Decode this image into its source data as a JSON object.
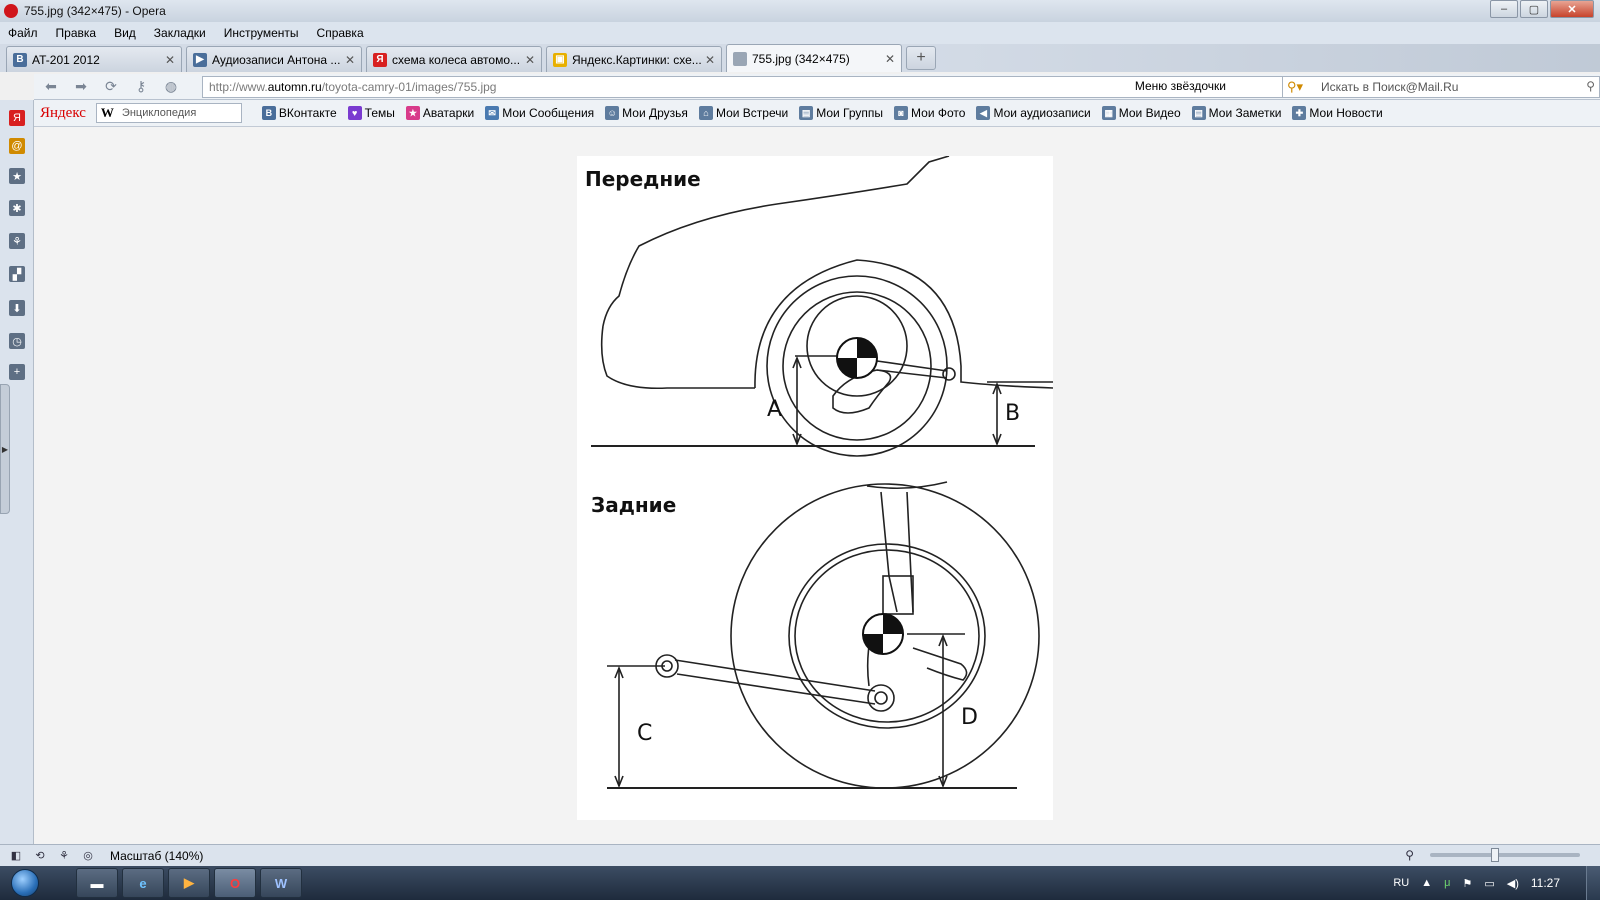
{
  "window": {
    "title": "755.jpg (342×475) - Opera",
    "minimize": "‒",
    "maximize": "▢",
    "close": "✕"
  },
  "menu": [
    "Файл",
    "Правка",
    "Вид",
    "Закладки",
    "Инструменты",
    "Справка"
  ],
  "tabs": [
    {
      "label": "AT-201 2012",
      "icon": "vk-icon",
      "color": "#4a6e9a",
      "glyph": "B",
      "active": false
    },
    {
      "label": "Аудиозаписи Антона ...",
      "icon": "play-icon",
      "color": "#4a6e9a",
      "glyph": "▶",
      "active": false
    },
    {
      "label": "схема колеса автомо...",
      "icon": "yandex-icon",
      "color": "#d82020",
      "glyph": "Я",
      "active": false
    },
    {
      "label": "Яндекс.Картинки: схе...",
      "icon": "yandex-images-icon",
      "color": "#e8b000",
      "glyph": "▣",
      "active": false
    },
    {
      "label": "755.jpg (342×475)",
      "icon": "image-file-icon",
      "color": "#9aa6b5",
      "glyph": "",
      "active": true
    }
  ],
  "address": {
    "prefix": "http://www.",
    "host": "automn.ru",
    "path": "/toyota-camry-01/images/755.jpg",
    "speed_dial_label": "Меню звёздочки",
    "search_placeholder": "Искать в Поиск@Mail.Ru"
  },
  "yandex_bar": {
    "logo": "Яндекс",
    "search_placeholder": "Энциклопедия",
    "search_glyph": "W",
    "links": [
      {
        "label": "ВКонтакте",
        "icon": "vk-icon",
        "color": "#4a6e9a",
        "glyph": "B"
      },
      {
        "label": "Темы",
        "icon": "heart-icon",
        "color": "#7a3bd0",
        "glyph": "♥"
      },
      {
        "label": "Аватарки",
        "icon": "star-icon",
        "color": "#d83a8a",
        "glyph": "★"
      },
      {
        "label": "Мои Сообщения",
        "icon": "envelope-icon",
        "color": "#4a7ab0",
        "glyph": "✉"
      },
      {
        "label": "Мои Друзья",
        "icon": "person-icon",
        "color": "#5e7c9e",
        "glyph": "☺"
      },
      {
        "label": "Мои Встречи",
        "icon": "house-icon",
        "color": "#5e7c9e",
        "glyph": "⌂"
      },
      {
        "label": "Мои Группы",
        "icon": "group-icon",
        "color": "#5e7c9e",
        "glyph": "▤"
      },
      {
        "label": "Мои Фото",
        "icon": "camera-icon",
        "color": "#5e7c9e",
        "glyph": "◙"
      },
      {
        "label": "Мои аудиозаписи",
        "icon": "speaker-icon",
        "color": "#5e7c9e",
        "glyph": "◀"
      },
      {
        "label": "Мои Видео",
        "icon": "film-icon",
        "color": "#5e7c9e",
        "glyph": "▦"
      },
      {
        "label": "Мои Заметки",
        "icon": "note-icon",
        "color": "#5e7c9e",
        "glyph": "▤"
      },
      {
        "label": "Мои Новости",
        "icon": "plus-icon",
        "color": "#5e7c9e",
        "glyph": "✚"
      }
    ]
  },
  "left_panel": [
    {
      "icon": "yandex-icon",
      "glyph": "Я",
      "color": "#d82020"
    },
    {
      "icon": "mail-icon",
      "glyph": "@",
      "color": "#d08a00"
    },
    {
      "icon": "bookmarks-icon",
      "glyph": "★",
      "color": "#5e6f84"
    },
    {
      "icon": "widgets-icon",
      "glyph": "✱",
      "color": "#5e6f84"
    },
    {
      "icon": "unite-icon",
      "glyph": "⚘",
      "color": "#5e6f84"
    },
    {
      "icon": "notes-icon",
      "glyph": "▞",
      "color": "#5e6f84"
    },
    {
      "icon": "downloads-icon",
      "glyph": "⬇",
      "color": "#5e6f84"
    },
    {
      "icon": "history-icon",
      "glyph": "◷",
      "color": "#5e6f84"
    },
    {
      "icon": "add-panel-icon",
      "glyph": "+",
      "color": "#5e6f84"
    }
  ],
  "diagram": {
    "front_title": "Передние",
    "rear_title": "Задние",
    "labels": {
      "A": "A",
      "B": "B",
      "C": "C",
      "D": "D"
    }
  },
  "status": {
    "zoom_label": "Масштаб (140%)",
    "zoom_percent": 140
  },
  "taskbar": {
    "apps": [
      {
        "icon": "explorer-icon",
        "glyph": "▬"
      },
      {
        "icon": "ie-icon",
        "glyph": "e"
      },
      {
        "icon": "media-player-icon",
        "glyph": "▶"
      },
      {
        "icon": "opera-icon",
        "glyph": "O",
        "active": true
      },
      {
        "icon": "word-icon",
        "glyph": "W"
      }
    ],
    "lang": "RU",
    "clock": "11:27"
  }
}
